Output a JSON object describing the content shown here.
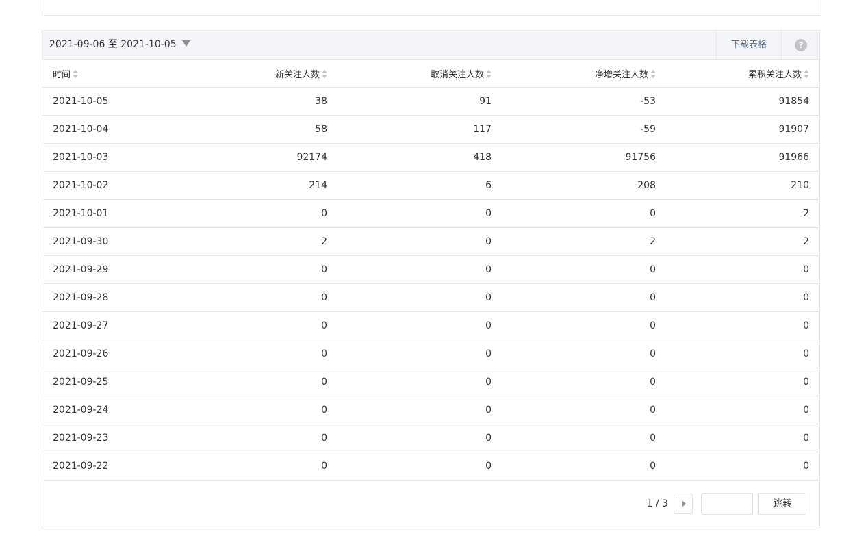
{
  "toolbar": {
    "date_range": "2021-09-06 至 2021-10-05",
    "download_label": "下载表格",
    "help_glyph": "?"
  },
  "table": {
    "headers": [
      "时间",
      "新关注人数",
      "取消关注人数",
      "净增关注人数",
      "累积关注人数"
    ],
    "rows": [
      [
        "2021-10-05",
        "38",
        "91",
        "-53",
        "91854"
      ],
      [
        "2021-10-04",
        "58",
        "117",
        "-59",
        "91907"
      ],
      [
        "2021-10-03",
        "92174",
        "418",
        "91756",
        "91966"
      ],
      [
        "2021-10-02",
        "214",
        "6",
        "208",
        "210"
      ],
      [
        "2021-10-01",
        "0",
        "0",
        "0",
        "2"
      ],
      [
        "2021-09-30",
        "2",
        "0",
        "2",
        "2"
      ],
      [
        "2021-09-29",
        "0",
        "0",
        "0",
        "0"
      ],
      [
        "2021-09-28",
        "0",
        "0",
        "0",
        "0"
      ],
      [
        "2021-09-27",
        "0",
        "0",
        "0",
        "0"
      ],
      [
        "2021-09-26",
        "0",
        "0",
        "0",
        "0"
      ],
      [
        "2021-09-25",
        "0",
        "0",
        "0",
        "0"
      ],
      [
        "2021-09-24",
        "0",
        "0",
        "0",
        "0"
      ],
      [
        "2021-09-23",
        "0",
        "0",
        "0",
        "0"
      ],
      [
        "2021-09-22",
        "0",
        "0",
        "0",
        "0"
      ]
    ]
  },
  "pager": {
    "page_info": "1 / 3",
    "jump_input_value": "",
    "jump_label": "跳转"
  },
  "colors": {
    "link": "#576b95",
    "toolbar_bg": "#f4f5f9",
    "border": "#e7e7eb"
  }
}
